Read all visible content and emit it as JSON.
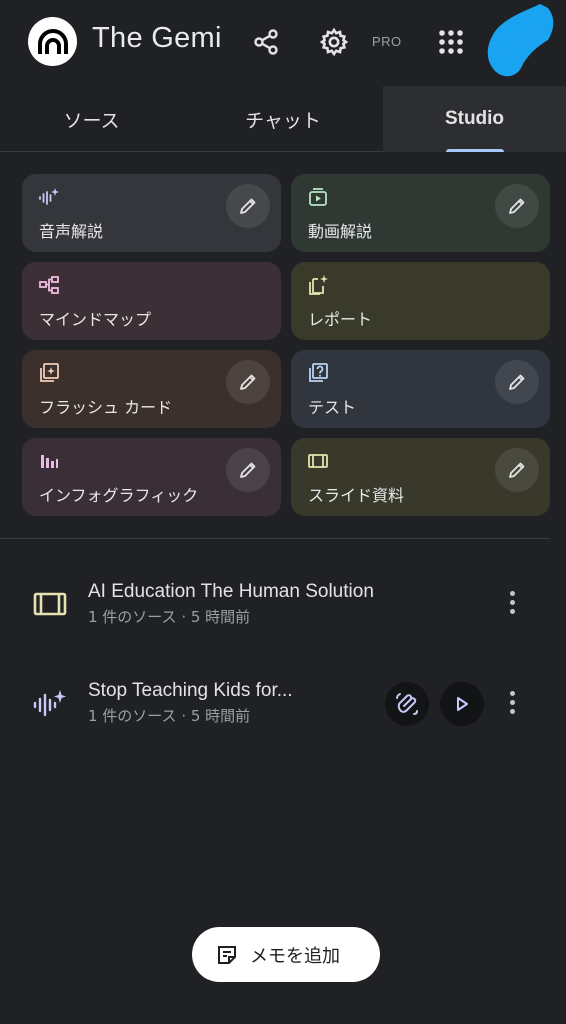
{
  "app": {
    "title": "The Gemi",
    "badge": "PRO"
  },
  "tabs": [
    {
      "label": "ソース"
    },
    {
      "label": "チャット"
    },
    {
      "label": "Studio"
    }
  ],
  "cards": [
    {
      "label": "音声解説",
      "icon": "audio-sparkle-icon",
      "color": "#34363b",
      "editable": true
    },
    {
      "label": "動画解説",
      "icon": "video-icon",
      "color": "#2f3833",
      "editable": true
    },
    {
      "label": "マインドマップ",
      "icon": "mindmap-icon",
      "color": "#3c3036",
      "editable": false
    },
    {
      "label": "レポート",
      "icon": "report-icon",
      "color": "#3a3a2a",
      "editable": false
    },
    {
      "label": "フラッシュ カード",
      "icon": "flashcard-icon",
      "color": "#3b302b",
      "editable": true
    },
    {
      "label": "テスト",
      "icon": "quiz-icon",
      "color": "#30353e",
      "editable": true
    },
    {
      "label": "インフォグラフィック",
      "icon": "infographic-icon",
      "color": "#3a2f36",
      "editable": true
    },
    {
      "label": "スライド資料",
      "icon": "slides-icon",
      "color": "#38382b",
      "editable": true
    }
  ],
  "items": [
    {
      "title": "AI Education The Human Solution",
      "subtitle": "1 件のソース · 5 時間前",
      "icon": "slides-icon"
    },
    {
      "title": "Stop Teaching Kids for...",
      "subtitle": "1 件のソース · 5 時間前",
      "icon": "audio-sparkle-icon"
    }
  ],
  "memo_button": {
    "label": "メモを追加"
  },
  "colors": {
    "accent": "#a8c7fa",
    "background": "#202124"
  }
}
